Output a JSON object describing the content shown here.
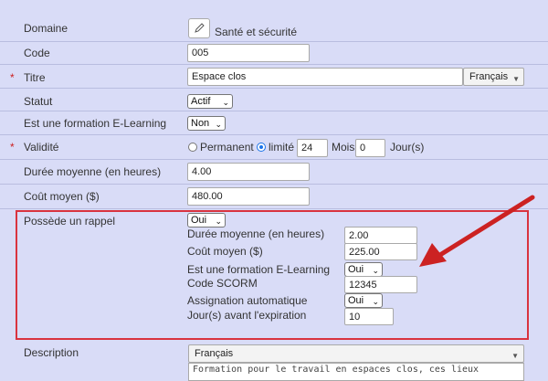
{
  "domaine": {
    "label": "Domaine",
    "value": "Santé et sécurité"
  },
  "code": {
    "label": "Code",
    "value": "005"
  },
  "titre": {
    "label": "Titre",
    "required": "*",
    "value": "Espace clos",
    "language": "Français"
  },
  "statut": {
    "label": "Statut",
    "value": "Actif"
  },
  "elearning": {
    "label": "Est une formation E-Learning",
    "value": "Non"
  },
  "validite": {
    "label": "Validité",
    "required": "*",
    "permanent_label": "Permanent",
    "limite_label": "limité",
    "mois_value": "24",
    "mois_label": "Mois",
    "jours_value": "0",
    "jours_label": "Jour(s)"
  },
  "duree": {
    "label": "Durée moyenne (en heures)",
    "value": "4.00"
  },
  "cout": {
    "label": "Coût moyen ($)",
    "value": "480.00"
  },
  "rappel": {
    "label": "Possède un rappel",
    "value": "Oui",
    "duree_label": "Durée moyenne (en heures)",
    "duree_value": "2.00",
    "cout_label": "Coût moyen ($)",
    "cout_value": "225.00",
    "elearning_label": "Est une formation E-Learning",
    "elearning_value": "Oui",
    "scorm_label": "Code SCORM",
    "scorm_value": "12345",
    "assignation_label": "Assignation automatique",
    "assignation_value": "Oui",
    "expiration_label": "Jour(s) avant l'expiration",
    "expiration_value": "10"
  },
  "description": {
    "label": "Description",
    "language": "Français",
    "text": "Formation pour le travail en espaces clos, ces lieux"
  },
  "colors": {
    "background": "#d9dcf7",
    "highlight_border": "#d9333f",
    "arrow": "#cc2222",
    "radio_accent": "#1a73e8"
  },
  "icons": {
    "edit": "pencil-icon",
    "annotation": "arrow-icon"
  }
}
